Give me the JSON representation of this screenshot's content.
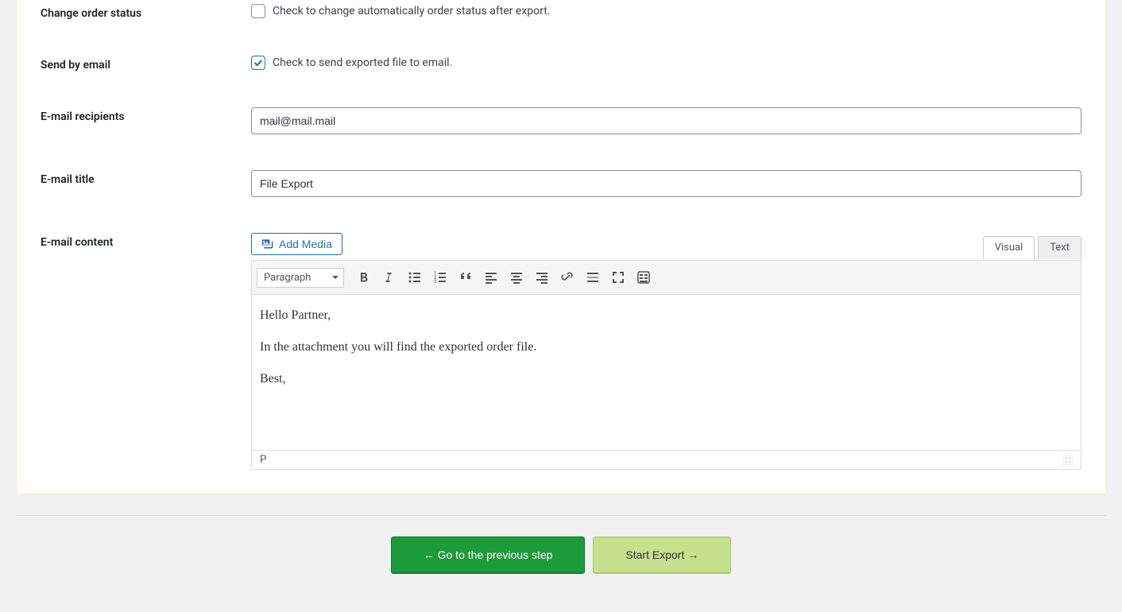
{
  "form": {
    "change_status": {
      "label": "Change order status",
      "checkbox_label": "Check to change automatically order status after export.",
      "checked": false
    },
    "send_email": {
      "label": "Send by email",
      "checkbox_label": "Check to send exported file to email.",
      "checked": true
    },
    "recipients": {
      "label": "E-mail recipients",
      "value": "mail@mail.mail"
    },
    "title": {
      "label": "E-mail title",
      "value": "File Export"
    },
    "content": {
      "label": "E-mail content",
      "add_media": "Add Media",
      "tabs": {
        "visual": "Visual",
        "text": "Text"
      },
      "format_select": "Paragraph",
      "body": {
        "p1": "Hello Partner,",
        "p2": "In the attachment you will find the exported order file.",
        "p3": "Best,"
      },
      "status_path": "P"
    }
  },
  "buttons": {
    "prev": "← Go to the previous step",
    "start": "Start Export →"
  }
}
